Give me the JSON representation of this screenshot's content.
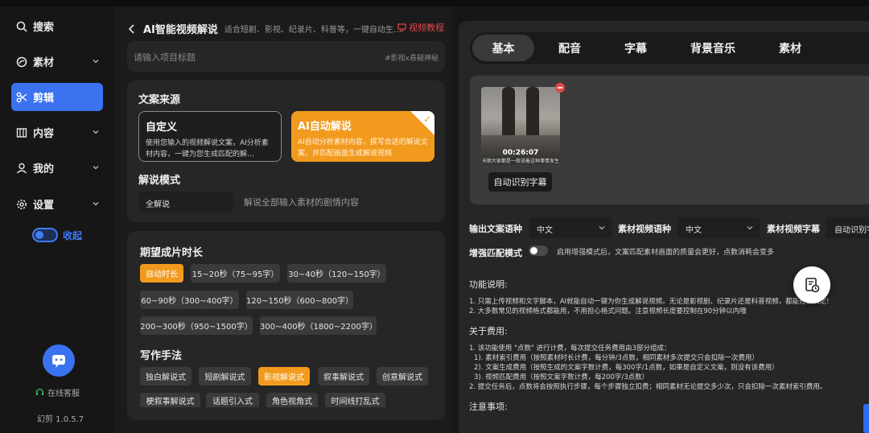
{
  "sidebar": {
    "items": [
      {
        "label": "搜索",
        "icon": "search-icon",
        "chevron": false
      },
      {
        "label": "素材",
        "icon": "material-icon",
        "chevron": true
      },
      {
        "label": "剪辑",
        "icon": "scissors-icon",
        "chevron": false,
        "active": true
      },
      {
        "label": "内容",
        "icon": "book-icon",
        "chevron": true
      },
      {
        "label": "我的",
        "icon": "user-icon",
        "chevron": true
      },
      {
        "label": "设置",
        "icon": "gear-icon",
        "chevron": true
      }
    ],
    "collapse_label": "收起",
    "support_label": "在线客服",
    "version": "幻剪 1.0.5.7"
  },
  "mid": {
    "title": "AI智能视频解说",
    "subtitle": "适合短剧、影视、纪录片、科普等，一键自动生…",
    "tutorial": "视频教程",
    "title_placeholder": "请输入项目标题",
    "title_tag": "#影视x悬疑神秘",
    "source": {
      "heading": "文案来源",
      "custom_title": "自定义",
      "custom_desc": "使用您输入的视频解说文案，AI分析素材内容，一键为您生成匹配的解…",
      "ai_title": "AI自动解说",
      "ai_desc": "AI自动分析素材内容，撰写合适的解说文案，并匹配画面生成解说视频"
    },
    "mode": {
      "heading": "解说模式",
      "value": "全解说",
      "desc": "解说全部输入素材的剧情内容"
    },
    "duration": {
      "heading": "期望成片时长",
      "options": [
        "自动时长",
        "15~20秒（75~95字）",
        "30~40秒（120~150字）",
        "60~90秒（300~400字）",
        "120~150秒（600~800字）",
        "200~300秒（950~1500字）",
        "300~400秒（1800~2200字）"
      ],
      "selected": "自动时长"
    },
    "style": {
      "heading": "写作手法",
      "options": [
        "独白解说式",
        "短剧解说式",
        "影视解说式",
        "叙事解说式",
        "创意解说式",
        "梗叙事解说式",
        "话题引入式",
        "角色视角式",
        "时间线打乱式"
      ],
      "selected": "影视解说式"
    }
  },
  "right": {
    "tabs": [
      "基本",
      "配音",
      "字幕",
      "背景音乐",
      "素材"
    ],
    "active_tab": "基本",
    "thumb_time": "00:26:07",
    "thumb_caption": "天朝大家都是一般说着这种事情发生",
    "auto_subtitle_btn": "自动识别字幕",
    "output_lang_label": "输出文案语种",
    "output_lang_value": "中文",
    "material_lang_label": "素材视频语种",
    "material_lang_value": "中文",
    "material_sub_label": "素材视频字幕",
    "material_sub_value": "自动识别字",
    "enhance_label": "增强匹配模式",
    "enhance_on": false,
    "enhance_desc": "启用增强模式后，文案匹配素材画面的质量会更好，点数消耗会变多",
    "func_title": "功能说明:",
    "func_lines": [
      "1. 只需上传视频和文字脚本，AI就能自动一键为你生成解说视频。无论是影视剧、纪录片还是科普视频，都能轻松搞定!",
      "2. 大多数常见的视频格式都能用，不用担心格式问题。注意视频长度要控制在90分钟以内哦"
    ],
    "fee_title": "关于费用:",
    "fee_lines": [
      "1. 该功能使用 \"点数\" 进行计费，每次提交任务费用由3部分组成：",
      "   1). 素材索引费用（按照素材时长计费，每分钟/3点数，相同素材多次提交只会扣除一次费用）",
      "   2). 文案生成费用（按照生成的文案字数计费，每300字/1点数，如果是自定义文案，则没有该费用）",
      "   3). 视频匹配费用（按照文案字数计费，每200字/3点数）",
      "2. 提交任务后，点数将会按照执行步骤，每个步骤独立扣费；相同素材无论提交多少次，只会扣除一次素材索引费用。"
    ],
    "notes_title": "注意事项:"
  },
  "colors": {
    "accent_blue": "#3a72f0",
    "accent_orange": "#f29a1e",
    "tutorial_red": "#e64646"
  }
}
